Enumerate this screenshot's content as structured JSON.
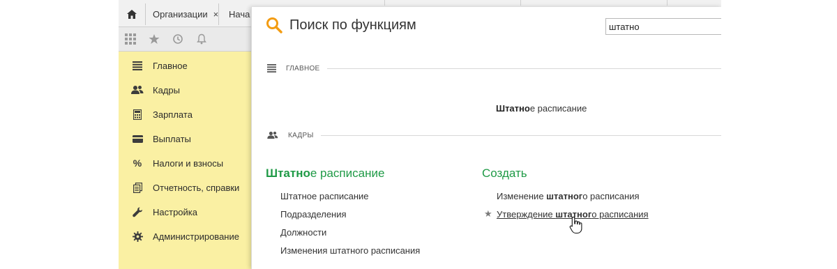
{
  "tabs": {
    "organizations": "Организации",
    "close_glyph": "×",
    "start_page": "Нача"
  },
  "sidebar": {
    "items": [
      {
        "label": "Главное",
        "icon": "menu-lines-icon"
      },
      {
        "label": "Кадры",
        "icon": "people-icon"
      },
      {
        "label": "Зарплата",
        "icon": "calculator-icon"
      },
      {
        "label": "Выплаты",
        "icon": "wallet-icon"
      },
      {
        "label": "Налоги и взносы",
        "icon": "percent-icon"
      },
      {
        "label": "Отчетность, справки",
        "icon": "documents-icon"
      },
      {
        "label": "Настройка",
        "icon": "wrench-icon"
      },
      {
        "label": "Администрирование",
        "icon": "gear-icon"
      }
    ]
  },
  "panel": {
    "title": "Поиск по функциям",
    "search_value": "штатно",
    "sections": {
      "main": {
        "label": "ГЛАВНОЕ",
        "result_bold": "Штатно",
        "result_rest": "е расписание"
      },
      "hr": {
        "label": "КАДРЫ",
        "group1": {
          "title_bold": "Штатно",
          "title_rest": "е расписание",
          "items": [
            "Штатное расписание",
            "Подразделения",
            "Должности",
            "Изменения штатного расписания"
          ]
        },
        "group2": {
          "title": "Создать",
          "item1": {
            "before": "Изменение ",
            "bold": "штатног",
            "after": "о расписания"
          },
          "item2": {
            "before": "Утверждение ",
            "bold": "штатног",
            "after": "о расписания"
          },
          "star": "★"
        }
      }
    }
  },
  "colors": {
    "sidebar_bg": "#faf0a3",
    "accent_green": "#1f9a46",
    "search_icon": "#f39c12"
  }
}
